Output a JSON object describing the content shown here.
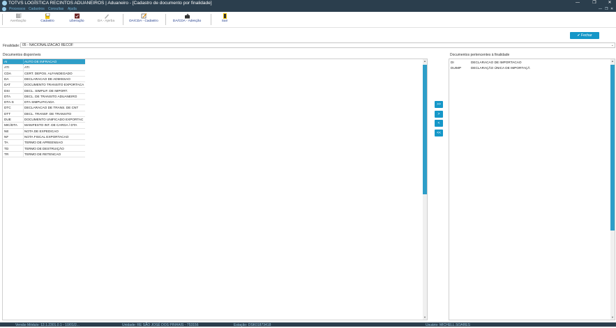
{
  "window": {
    "title": "TOTVS LOGÍSTICA RECINTOS ADUANEIROS | Aduaneiro - [Cadastro de documento por finalidade]",
    "controls": [
      "—",
      "❐",
      "✕"
    ]
  },
  "menubar": {
    "items": [
      "Processos",
      "Cadastros",
      "Consultas",
      "Ajuda"
    ],
    "right_controls": [
      "—",
      "❐",
      "✕"
    ]
  },
  "toolbar": {
    "buttons": [
      {
        "label": "Averbação",
        "icon": "document-stack-icon"
      },
      {
        "label": "Cadastro",
        "icon": "document-folder-icon"
      },
      {
        "label": "Liberação",
        "icon": "release-icon"
      },
      {
        "label": "DA - Ajerba",
        "icon": "pen-icon"
      },
      {
        "label": "DA/CDA - Cadastro",
        "icon": "edit-document-icon"
      },
      {
        "label": "DA/CDA - Adesção",
        "icon": "share-icon"
      },
      {
        "label": "Sair",
        "icon": "exit-door-icon"
      }
    ]
  },
  "fechar_label": "Fechar",
  "finalidade": {
    "label": "Finalidade:",
    "value": "05 - NACIONALIZACAO RECOF"
  },
  "available": {
    "title": "Documentos disponíveis",
    "rows": [
      {
        "code": "AI",
        "desc": "AUTO DE INFRACAO"
      },
      {
        "code": "ATI",
        "desc": "ATI"
      },
      {
        "code": "CDA",
        "desc": "CERT. DEPOS. ALFANDEGADO"
      },
      {
        "code": "DA",
        "desc": "DECLARACAO DE ADMISSAO"
      },
      {
        "code": "DAT",
        "desc": "DOCUMENTO TRANSITO EXPORTACA"
      },
      {
        "code": "DSI",
        "desc": "DECL. SIMPLIF. DE IMPORT."
      },
      {
        "code": "DTA",
        "desc": "DECL. DE TRANSITO ADUANEIRO"
      },
      {
        "code": "DTA-S",
        "desc": "DTA SIMPLIFICADA"
      },
      {
        "code": "DTC",
        "desc": "DECLARACAO DE TRANS. DE CNT"
      },
      {
        "code": "DTT",
        "desc": "DECL. TRANSF. DE TRANSITO"
      },
      {
        "code": "DUE",
        "desc": "DOCUMENTO UNIFICADO EXPORTAC"
      },
      {
        "code": "MIC/DTA",
        "desc": "MANIFESTO INT. DE CARGA / DTA"
      },
      {
        "code": "NE",
        "desc": "NOTA DE EXPEDICAO"
      },
      {
        "code": "NF",
        "desc": "NOTA FISCAL EXPORTACAO"
      },
      {
        "code": "TA",
        "desc": "TERMO DE APREENSAO"
      },
      {
        "code": "TD",
        "desc": "TERMO DE DESTRUIÇÃO"
      },
      {
        "code": "TR",
        "desc": "TERMO DE RETENCAO"
      }
    ]
  },
  "assigned": {
    "title": "Documentos pertencentes à finalidade",
    "rows": [
      {
        "code": "DI",
        "desc": "DECLARACAO DE IMPORTACAO"
      },
      {
        "code": "DUIMP",
        "desc": "DECLARAÇÃO ÚNICA DE IMPORTAÇÃ"
      }
    ]
  },
  "move_buttons": [
    ">>",
    ">",
    "<",
    "<<"
  ],
  "status": {
    "items": [
      "Versão Módulo: 12.1.2301.0.1 - 10/01/2...",
      "Unidade: RE SÃO JOSÉ DOS PINHAIS - 753156",
      "Estação: DSK01873418",
      "Usuário: MICHELL.SOARES"
    ]
  },
  "colors": {
    "titlebar": "#2b3e4d",
    "accent": "#1597c8",
    "selection": "#2e9ec8"
  }
}
